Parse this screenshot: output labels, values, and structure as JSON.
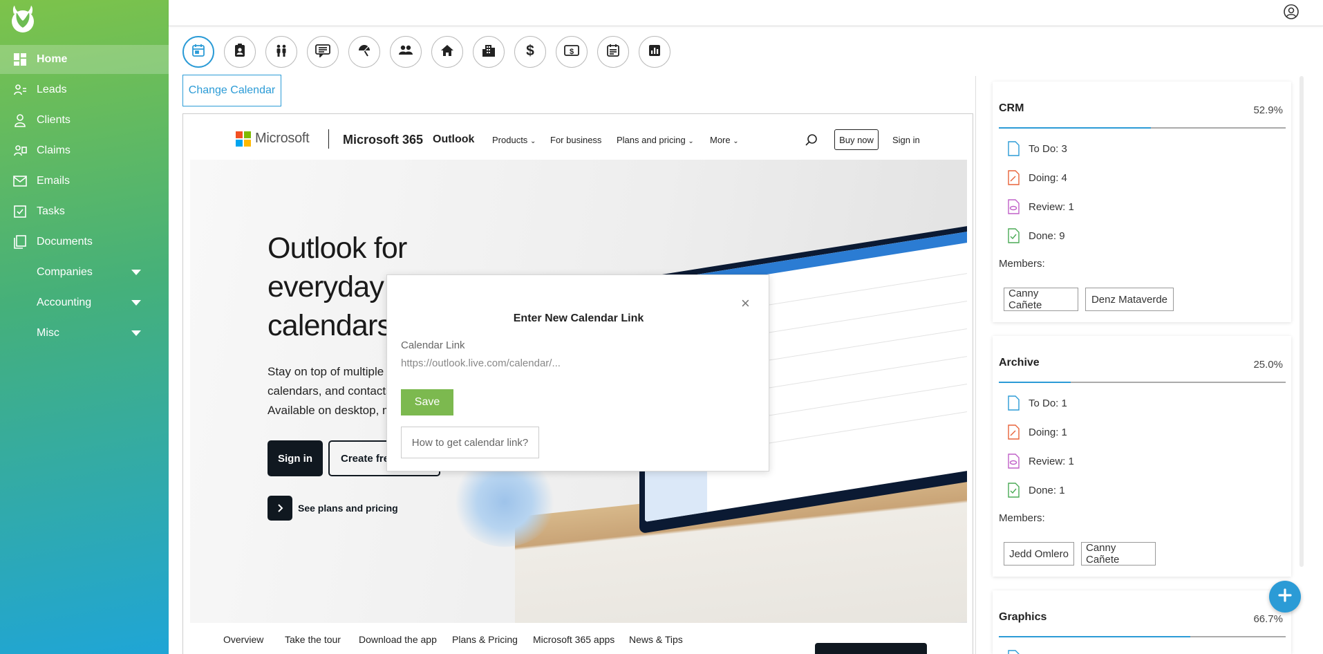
{
  "sidebar": {
    "items": [
      {
        "label": "Home",
        "icon": "dashboard-icon",
        "active": true
      },
      {
        "label": "Leads",
        "icon": "leads-icon"
      },
      {
        "label": "Clients",
        "icon": "clients-icon"
      },
      {
        "label": "Claims",
        "icon": "claims-icon"
      },
      {
        "label": "Emails",
        "icon": "mail-icon"
      },
      {
        "label": "Tasks",
        "icon": "tasks-icon"
      },
      {
        "label": "Documents",
        "icon": "documents-icon"
      },
      {
        "label": "Companies",
        "icon": "none",
        "expandable": true
      },
      {
        "label": "Accounting",
        "icon": "none",
        "expandable": true
      },
      {
        "label": "Misc",
        "icon": "none",
        "expandable": true
      }
    ]
  },
  "toolbar": {
    "icons": [
      "calendar-icon",
      "contact-badge-icon",
      "people-icon",
      "message-icon",
      "umbrella-icon",
      "group-icon",
      "house-icon",
      "building-icon",
      "dollar-icon",
      "money-bill-icon",
      "schedule-icon",
      "chart-icon"
    ],
    "active_index": 0,
    "change_calendar_label": "Change Calendar"
  },
  "embedded": {
    "brand": "Microsoft",
    "product": "Microsoft 365",
    "app": "Outlook",
    "nav_links": [
      "Products",
      "For business",
      "Plans and pricing",
      "More"
    ],
    "buy_now": "Buy now",
    "sign_in_top": "Sign in",
    "hero_title": "Outlook for everyday calendars",
    "hero_title_lines": [
      "Outlook for",
      "everyday",
      "calendars"
    ],
    "hero_text_lines": [
      "Stay on top of multiple",
      "calendars, and contacts",
      "Available on desktop, m"
    ],
    "sign_in_button": "Sign in",
    "create_button": "Create free",
    "plans_link": "See plans and pricing",
    "footer_links": [
      "Overview",
      "Take the tour",
      "Download the app",
      "Plans & Pricing",
      "Microsoft 365 apps",
      "News & Tips"
    ]
  },
  "modal": {
    "title": "Enter New Calendar Link",
    "close": "×",
    "label": "Calendar Link",
    "input_value": "",
    "input_placeholder": "https://outlook.live.com/calendar/...",
    "save_label": "Save",
    "help_label": "How to get calendar link?"
  },
  "projects": [
    {
      "name": "CRM",
      "percent": "52.9%",
      "progress": 0.529,
      "tasks": [
        "To Do: 3",
        "Doing: 4",
        "Review: 1",
        "Done: 9"
      ],
      "members_label": "Members:",
      "members": [
        "Canny Cañete",
        "Denz Mataverde"
      ]
    },
    {
      "name": "Archive",
      "percent": "25.0%",
      "progress": 0.25,
      "tasks": [
        "To Do: 1",
        "Doing: 1",
        "Review: 1",
        "Done: 1"
      ],
      "members_label": "Members:",
      "members": [
        "Jedd Omlero",
        "Canny Cañete"
      ]
    },
    {
      "name": "Graphics",
      "percent": "66.7%",
      "progress": 0.667
    }
  ],
  "colors": {
    "accent": "#2b9bd6",
    "save": "#7cb94f",
    "todo": "#2b9bd6",
    "doing": "#e8643a",
    "review": "#c060c8",
    "done": "#4aaa55"
  }
}
